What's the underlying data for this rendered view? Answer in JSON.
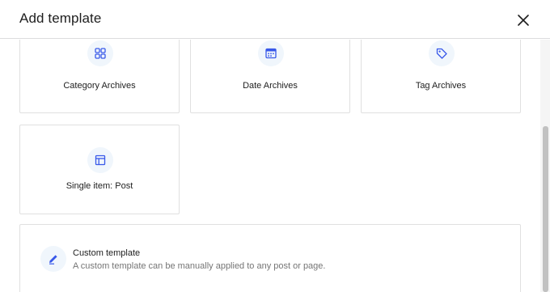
{
  "modal": {
    "title": "Add template",
    "close_icon": "close-icon"
  },
  "templates": [
    {
      "label": "Category Archives",
      "icon": "category-grid-icon"
    },
    {
      "label": "Date Archives",
      "icon": "calendar-icon"
    },
    {
      "label": "Tag Archives",
      "icon": "tag-icon"
    },
    {
      "label": "Single item: Post",
      "icon": "layout-icon"
    }
  ],
  "custom_template": {
    "title": "Custom template",
    "description": "A custom template can be manually applied to any post or page.",
    "icon": "pencil-icon"
  },
  "colors": {
    "accent": "#3858e9",
    "icon_bg": "#f0f6fc",
    "border": "#e0e0e0"
  }
}
